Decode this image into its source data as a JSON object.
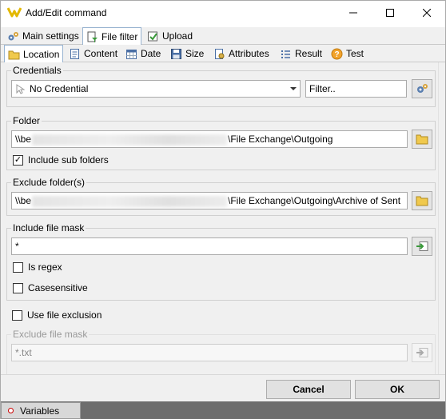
{
  "window": {
    "title": "Add/Edit command"
  },
  "tabs_top": [
    {
      "label": "Main settings",
      "active": false
    },
    {
      "label": "File filter",
      "active": true
    },
    {
      "label": "Upload",
      "active": false
    }
  ],
  "tabs_sub": [
    {
      "label": "Location",
      "active": true
    },
    {
      "label": "Content",
      "active": false
    },
    {
      "label": "Date",
      "active": false
    },
    {
      "label": "Size",
      "active": false
    },
    {
      "label": "Attributes",
      "active": false
    },
    {
      "label": "Result",
      "active": false
    },
    {
      "label": "Test",
      "active": false
    }
  ],
  "credentials": {
    "legend": "Credentials",
    "selected": "No Credential",
    "filter_label": "Filter.."
  },
  "folder": {
    "legend": "Folder",
    "prefix": "\\\\be",
    "suffix": "\\File Exchange\\Outgoing",
    "include_sub_folders_label": "Include sub folders",
    "include_sub_folders": true
  },
  "exclude_folders": {
    "legend": "Exclude folder(s)",
    "prefix": "\\\\be",
    "suffix": "\\File Exchange\\Outgoing\\Archive of Sent"
  },
  "include_mask": {
    "legend": "Include file mask",
    "value": "*",
    "is_regex_label": "Is regex",
    "is_regex": false,
    "case_sensitive_label": "Casesensitive",
    "case_sensitive": false
  },
  "file_exclusion": {
    "label": "Use file exclusion",
    "checked": false,
    "mask_label": "Exclude file mask",
    "mask_value": "*.txt"
  },
  "footer": {
    "cancel": "Cancel",
    "ok": "OK"
  },
  "statusbar": {
    "variables_label": "Variables"
  },
  "colors": {
    "accent": "#99b4d1",
    "statusbar": "#6d6d6d",
    "folder_icon": "#e8c04a"
  }
}
